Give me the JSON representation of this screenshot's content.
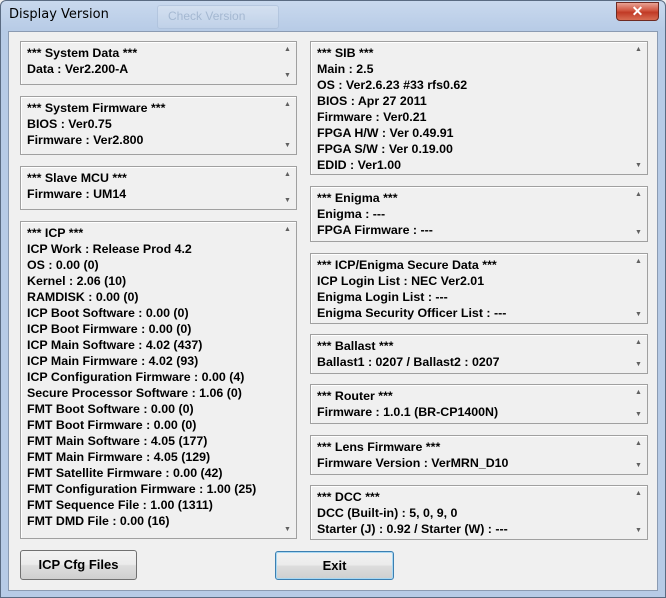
{
  "window": {
    "title": "Display Version",
    "background_tab": "Check Version",
    "close_symbol": "✕"
  },
  "panels": {
    "system_data": {
      "lines": [
        "*** System Data ***",
        "Data : Ver2.200-A"
      ]
    },
    "system_firmware": {
      "lines": [
        "*** System Firmware ***",
        "BIOS : Ver0.75",
        "Firmware : Ver2.800"
      ]
    },
    "slave_mcu": {
      "lines": [
        "*** Slave MCU ***",
        "Firmware : UM14"
      ]
    },
    "icp": {
      "lines": [
        "*** ICP ***",
        "ICP Work : Release Prod 4.2",
        "OS : 0.00 (0)",
        "Kernel : 2.06 (10)",
        "RAMDISK : 0.00 (0)",
        "ICP Boot Software : 0.00 (0)",
        "ICP Boot Firmware : 0.00 (0)",
        "ICP Main Software : 4.02 (437)",
        "ICP Main Firmware : 4.02 (93)",
        "ICP Configuration Firmware : 0.00 (4)",
        "Secure Processor Software : 1.06 (0)",
        "FMT Boot Software : 0.00 (0)",
        "FMT Boot Firmware : 0.00 (0)",
        "FMT Main Software : 4.05 (177)",
        "FMT Main Firmware : 4.05 (129)",
        "FMT Satellite Firmware : 0.00 (42)",
        "FMT Configuration Firmware : 1.00 (25)",
        "FMT Sequence File : 1.00 (1311)",
        "FMT DMD File : 0.00 (16)"
      ]
    },
    "sib": {
      "lines": [
        "*** SIB ***",
        "Main : 2.5",
        "OS : Ver2.6.23 #33 rfs0.62",
        "BIOS : Apr 27 2011",
        "Firmware : Ver0.21",
        "FPGA H/W : Ver 0.49.91",
        "FPGA S/W : Ver 0.19.00",
        "EDID : Ver1.00"
      ]
    },
    "enigma": {
      "lines": [
        "*** Enigma ***",
        "Enigma : ---",
        "FPGA Firmware : ---"
      ]
    },
    "secure_data": {
      "lines": [
        "*** ICP/Enigma Secure Data ***",
        "ICP Login List : NEC Ver2.01",
        "Enigma Login List : ---",
        "Enigma Security Officer List : ---"
      ]
    },
    "ballast": {
      "lines": [
        "*** Ballast ***",
        "Ballast1 : 0207 / Ballast2 : 0207"
      ]
    },
    "router": {
      "lines": [
        "*** Router ***",
        "Firmware : 1.0.1 (BR-CP1400N)"
      ]
    },
    "lens_firmware": {
      "lines": [
        "*** Lens Firmware ***",
        "Firmware Version : VerMRN_D10"
      ]
    },
    "dcc": {
      "lines": [
        "*** DCC ***",
        "DCC (Built-in) : 5, 0, 9, 0",
        "Starter (J) : 0.92 / Starter (W) : ---"
      ]
    }
  },
  "buttons": {
    "icp_cfg_files": "ICP Cfg Files",
    "exit": "Exit"
  },
  "scroll_arrows": {
    "up": "▲",
    "down": "▼"
  }
}
